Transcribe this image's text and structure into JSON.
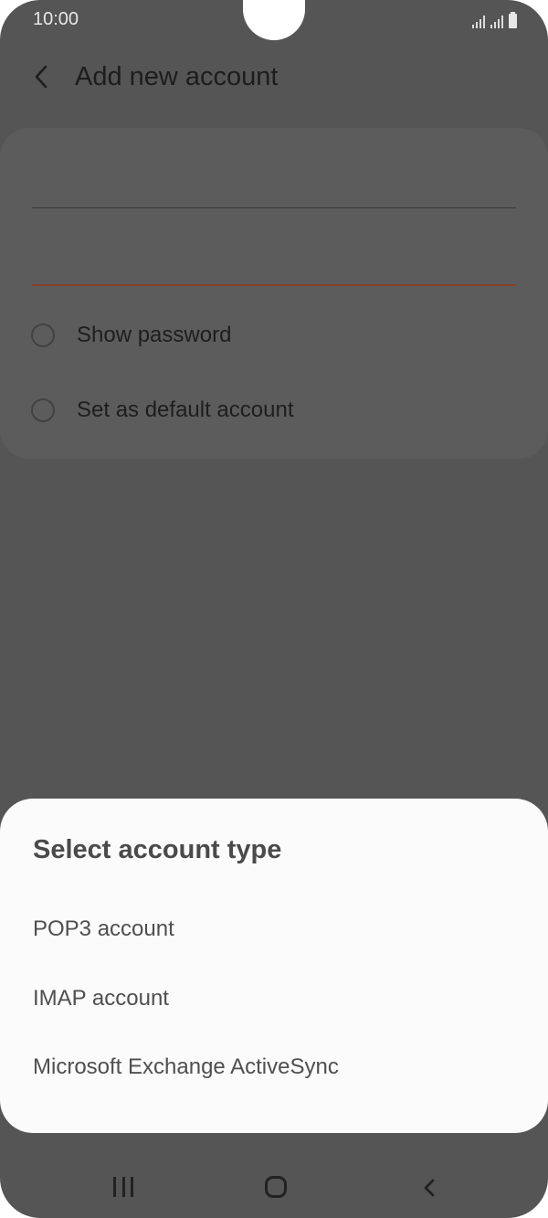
{
  "status_bar": {
    "time": "10:00",
    "icons": [
      "signal-icon",
      "signal-icon",
      "battery-icon"
    ]
  },
  "app_bar": {
    "back_icon": "back-arrow-icon",
    "title": "Add new account"
  },
  "form": {
    "email_value": "",
    "password_value": "",
    "show_password_label": "Show password",
    "default_account_label": "Set as default account"
  },
  "account_type_sheet": {
    "title": "Select account type",
    "options": [
      {
        "label": "POP3 account"
      },
      {
        "label": "IMAP account"
      },
      {
        "label": "Microsoft Exchange ActiveSync"
      }
    ]
  },
  "nav_bar": {
    "icons": [
      "recent-apps-icon",
      "home-icon",
      "back-icon"
    ]
  },
  "colors": {
    "scrim": "#555555",
    "sheet_background": "#fbfbfb",
    "accent_underline": "#8a3e28"
  }
}
